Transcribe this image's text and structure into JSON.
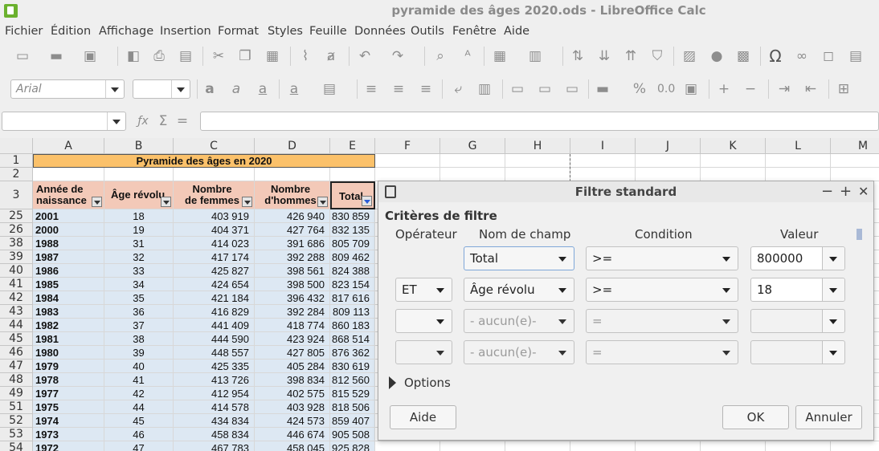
{
  "window": {
    "title": "pyramide des âges 2020.ods - LibreOffice Calc"
  },
  "menu": [
    "Fichier",
    "Édition",
    "Affichage",
    "Insertion",
    "Format",
    "Styles",
    "Feuille",
    "Données",
    "Outils",
    "Fenêtre",
    "Aide"
  ],
  "formatting": {
    "font_name": "Arial",
    "font_size": ""
  },
  "toolbar_icons": [
    "new-icon",
    "open-icon",
    "save-icon",
    "export-pdf-icon",
    "print-icon",
    "print-preview-icon",
    "cut-icon",
    "copy-icon",
    "paste-icon",
    "clone-icon",
    "clear-icon",
    "undo-icon",
    "redo-icon",
    "find-icon",
    "spelling-icon",
    "row-icon",
    "column-icon",
    "sort-icon",
    "sort-ascending-icon",
    "sort-descending-icon",
    "autofilter-icon",
    "image-icon",
    "chart-icon",
    "pivot-icon",
    "special-character-icon",
    "hyperlink-icon",
    "comment-icon",
    "header-footer-icon"
  ],
  "formula_bar": {
    "function_icon": "ƒx",
    "sum_icon": "Σ",
    "equals_icon": "="
  },
  "columns": [
    "A",
    "B",
    "C",
    "D",
    "E",
    "F",
    "G",
    "H",
    "I",
    "J",
    "K",
    "L",
    "M"
  ],
  "sheet": {
    "title_row": "1",
    "blank_row": "2",
    "header_row": "3",
    "title": "Pyramide des âges en 2020",
    "headers": [
      [
        "Année de",
        "naissance"
      ],
      [
        "Âge révolu"
      ],
      [
        "Nombre",
        "de femmes"
      ],
      [
        "Nombre",
        "d'hommes"
      ],
      [
        "Total"
      ]
    ],
    "rows": [
      {
        "row": "25",
        "year": "2001",
        "age": "18",
        "women": "403 919",
        "men": "426 940",
        "total": "830 859"
      },
      {
        "row": "26",
        "year": "2000",
        "age": "19",
        "women": "404 371",
        "men": "427 764",
        "total": "832 135"
      },
      {
        "row": "38",
        "year": "1988",
        "age": "31",
        "women": "414 023",
        "men": "391 686",
        "total": "805 709"
      },
      {
        "row": "39",
        "year": "1987",
        "age": "32",
        "women": "417 174",
        "men": "392 288",
        "total": "809 462"
      },
      {
        "row": "40",
        "year": "1986",
        "age": "33",
        "women": "425 827",
        "men": "398 561",
        "total": "824 388"
      },
      {
        "row": "41",
        "year": "1985",
        "age": "34",
        "women": "424 654",
        "men": "398 500",
        "total": "823 154"
      },
      {
        "row": "42",
        "year": "1984",
        "age": "35",
        "women": "421 184",
        "men": "396 432",
        "total": "817 616"
      },
      {
        "row": "43",
        "year": "1983",
        "age": "36",
        "women": "416 829",
        "men": "392 284",
        "total": "809 113"
      },
      {
        "row": "44",
        "year": "1982",
        "age": "37",
        "women": "441 409",
        "men": "418 774",
        "total": "860 183"
      },
      {
        "row": "45",
        "year": "1981",
        "age": "38",
        "women": "444 590",
        "men": "423 924",
        "total": "868 514"
      },
      {
        "row": "46",
        "year": "1980",
        "age": "39",
        "women": "448 557",
        "men": "427 805",
        "total": "876 362"
      },
      {
        "row": "47",
        "year": "1979",
        "age": "40",
        "women": "425 335",
        "men": "405 284",
        "total": "830 619"
      },
      {
        "row": "48",
        "year": "1978",
        "age": "41",
        "women": "413 726",
        "men": "398 834",
        "total": "812 560"
      },
      {
        "row": "49",
        "year": "1977",
        "age": "42",
        "women": "412 954",
        "men": "402 575",
        "total": "815 529"
      },
      {
        "row": "51",
        "year": "1975",
        "age": "44",
        "women": "414 578",
        "men": "403 928",
        "total": "818 506"
      },
      {
        "row": "52",
        "year": "1974",
        "age": "45",
        "women": "434 834",
        "men": "424 573",
        "total": "859 407"
      },
      {
        "row": "53",
        "year": "1973",
        "age": "46",
        "women": "458 834",
        "men": "446 674",
        "total": "905 508"
      },
      {
        "row": "54",
        "year": "1972",
        "age": "47",
        "women": "467 783",
        "men": "458 045",
        "total": "925 828"
      }
    ]
  },
  "dialog": {
    "title": "Filtre standard",
    "section": "Critères de filtre",
    "col_operator": "Opérateur",
    "col_field": "Nom de champ",
    "col_condition": "Condition",
    "col_value": "Valeur",
    "conditions": [
      {
        "operator": "",
        "field": "Total",
        "condition": ">=",
        "value": "800000"
      },
      {
        "operator": "ET",
        "field": "Âge révolu",
        "condition": ">=",
        "value": "18"
      },
      {
        "operator": "",
        "field": "- aucun(e)-",
        "condition": "=",
        "value": ""
      },
      {
        "operator": "",
        "field": "- aucun(e)-",
        "condition": "=",
        "value": ""
      }
    ],
    "options_label": "Options",
    "help_label": "Aide",
    "ok_label": "OK",
    "cancel_label": "Annuler",
    "minimize": "−",
    "maximize": "+",
    "close": "✕"
  }
}
